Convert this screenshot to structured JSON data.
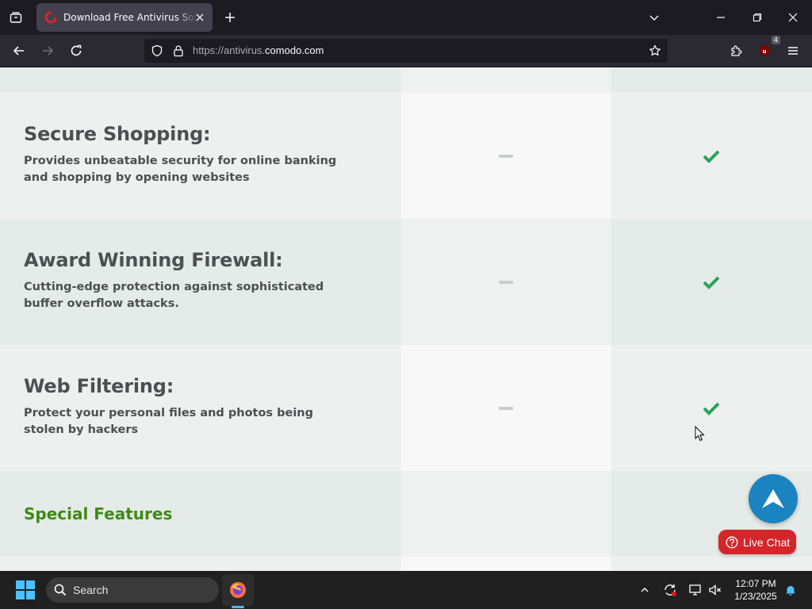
{
  "browser": {
    "tab": {
      "title": "Download Free Antivirus Software | Comodo"
    },
    "url": {
      "prefix": "https://antivirus.",
      "domain": "comodo.com"
    },
    "extension_badge": "4"
  },
  "features": [
    {
      "title": "Secure Shopping:",
      "description": "Provides unbeatable security for online banking and shopping by opening websites",
      "free": "not-included",
      "pro": "included"
    },
    {
      "title": "Award Winning Firewall:",
      "description": "Cutting-edge protection against sophisticated buffer overflow attacks.",
      "free": "not-included",
      "pro": "included"
    },
    {
      "title": "Web Filtering:",
      "description": "Protect your personal files and photos being stolen by hackers",
      "free": "not-included",
      "pro": "included"
    }
  ],
  "section_heading": "Special Features",
  "live_chat": {
    "label": "Live Chat"
  },
  "taskbar": {
    "search_label": "Search",
    "time": "12:07 PM",
    "date": "1/23/2025"
  },
  "colors": {
    "check_green": "#27a35a",
    "section_green": "#3f8a13",
    "live_chat_red": "#d4262a",
    "scroll_top_blue": "#1a83c0"
  }
}
